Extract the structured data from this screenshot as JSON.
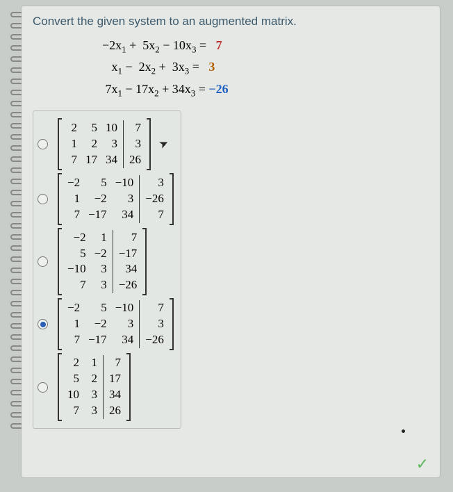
{
  "prompt": "Convert the given system to an augmented matrix.",
  "system": {
    "r1": {
      "lhs": "−2x₁ +  5x₂ − 10x₃ =",
      "rhs": "7",
      "cls": "c7"
    },
    "r2": {
      "lhs": "x₁ −  2x₂ +  3x₃ =",
      "rhs": "3",
      "cls": "c3"
    },
    "r3": {
      "lhs": "7x₁ − 17x₂ + 34x₃ =",
      "rhs": "−26",
      "cls": "c26"
    }
  },
  "options": [
    {
      "checked": false,
      "cols": [
        [
          "2",
          "1",
          "7"
        ],
        [
          "5",
          "2",
          "17"
        ],
        [
          "10",
          "3",
          "34"
        ]
      ],
      "aug": [
        "7",
        "3",
        "26"
      ],
      "cursor": true
    },
    {
      "checked": false,
      "cols": [
        [
          "−2",
          "1",
          "7"
        ],
        [
          "5",
          "−2",
          "−17"
        ],
        [
          "−10",
          "3",
          "34"
        ]
      ],
      "aug": [
        "3",
        "−26",
        "7"
      ]
    },
    {
      "checked": false,
      "cols": [
        [
          "−2",
          "5",
          "−10",
          "7"
        ],
        [
          "1",
          "−2",
          "3",
          "3"
        ]
      ],
      "aug": [
        "7",
        "−17",
        "34",
        "−26"
      ]
    },
    {
      "checked": true,
      "cols": [
        [
          "−2",
          "1",
          "7"
        ],
        [
          "5",
          "−2",
          "−17"
        ],
        [
          "−10",
          "3",
          "34"
        ]
      ],
      "aug": [
        "7",
        "3",
        "−26"
      ]
    },
    {
      "checked": false,
      "cols": [
        [
          "2",
          "5",
          "10",
          "7"
        ],
        [
          "1",
          "2",
          "3",
          "3"
        ]
      ],
      "aug": [
        "7",
        "17",
        "34",
        "26"
      ]
    }
  ]
}
